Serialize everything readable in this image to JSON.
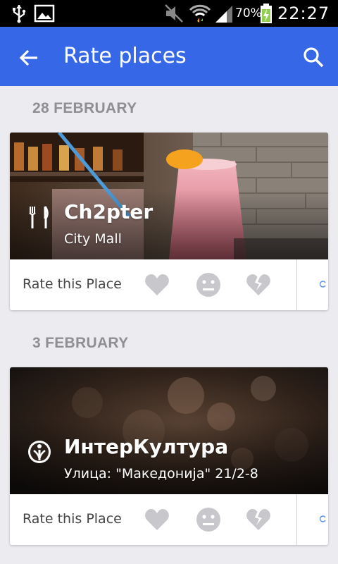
{
  "status_bar": {
    "battery": "70%",
    "time": "22:27",
    "icons": [
      "usb-icon",
      "image-icon",
      "mute-icon",
      "wifi-icon",
      "signal-icon",
      "battery-charging-icon"
    ]
  },
  "app_bar": {
    "title": "Rate places",
    "back_icon": "arrow-left-icon",
    "search_icon": "search-icon",
    "color": "#3667e6"
  },
  "sections": [
    {
      "date": "28 FEBRUARY",
      "place": {
        "name": "Ch2pter",
        "address": "City Mall",
        "icon": "cutlery-icon"
      },
      "rate_label": "Rate this Place"
    },
    {
      "date": "3 FEBRUARY",
      "place": {
        "name": "ИнтерКултура",
        "address": "Улица: \"Македонија\" 21/2-8",
        "icon": "culture-center-icon"
      },
      "rate_label": "Rate this Place"
    }
  ],
  "rating_options": [
    "heart-icon",
    "neutral-face-icon",
    "broken-heart-icon"
  ],
  "colors": {
    "background": "#ececf0",
    "rating_icon": "#c8c8cc",
    "section_date": "#8e8e93"
  }
}
